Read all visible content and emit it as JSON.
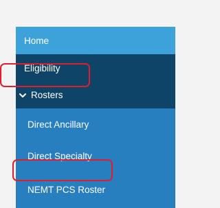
{
  "sidebar": {
    "items": [
      {
        "label": "Home",
        "color": "#3ea2da"
      },
      {
        "label": "Eligibility",
        "color": "#0f4469"
      },
      {
        "label": "Rosters",
        "icon": "chevron-down-icon",
        "color": "#0f4469"
      },
      {
        "label": "Direct Ancillary",
        "color": "#287fc0"
      },
      {
        "label": "Direct Specialty",
        "color": "#287fc0"
      },
      {
        "label": "NEMT PCS Roster",
        "color": "#287fc0"
      }
    ]
  },
  "annotations": {
    "highlight_color": "#e11d2b"
  }
}
